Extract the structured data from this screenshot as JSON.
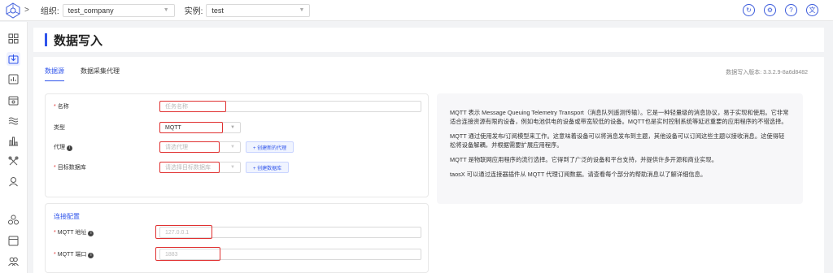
{
  "header": {
    "org_label": "组织:",
    "org_value": "test_company",
    "instance_label": "实例:",
    "instance_value": "test",
    "icons": [
      "refresh-icon",
      "settings-icon",
      "help-icon",
      "language-icon"
    ],
    "icon_glyphs": [
      "↻",
      "⚙",
      "?",
      "文"
    ]
  },
  "page": {
    "title": "数据写入",
    "tabs": [
      "数据源",
      "数据采集代理"
    ],
    "active_tab": 0,
    "version": "数据写入版本: 3.3.2.9-8a6d8482"
  },
  "form": {
    "name_label": "名称",
    "name_placeholder": "任务名称",
    "type_label": "类型",
    "type_value": "MQTT",
    "agent_label": "代理",
    "agent_placeholder": "请选代理",
    "agent_button": "+ 创建新的代理",
    "target_label": "目标数据库",
    "target_placeholder": "请选择目标数据库",
    "target_button": "+ 创建数据库",
    "connection_title": "连接配置",
    "mqtt_host_label": "MQTT 地址",
    "mqtt_host_placeholder": "127.0.0.1",
    "mqtt_port_label": "MQTT 端口",
    "mqtt_port_placeholder": "1883"
  },
  "description": [
    "MQTT 表示 Message Queuing Telemetry Transport（消息队列遥测传输）。它是一种轻量级的消息协议，易于实现和使用。它非常适合连接资源有限的设备，例如电池供电的设备或带宽较低的设备。MQTT也是实时控制系统等延迟重要的应用程序的不错选择。",
    "MQTT 通过使用发布/订阅模型来工作。这意味着设备可以将消息发布到主题，其他设备可以订阅这些主题以接收消息。这使得轻松将设备解耦，并根据需要扩展应用程序。",
    "MQTT 是物联网应用程序的流行选择。它得到了广泛的设备和平台支持，并提供许多开源和商业实现。",
    "taosX 可以通过连接器插件从 MQTT 代理订阅数据。请查看每个部分的帮助消息以了解详细信息。"
  ],
  "colors": {
    "accent": "#2f54eb",
    "highlight": "#e03131"
  }
}
